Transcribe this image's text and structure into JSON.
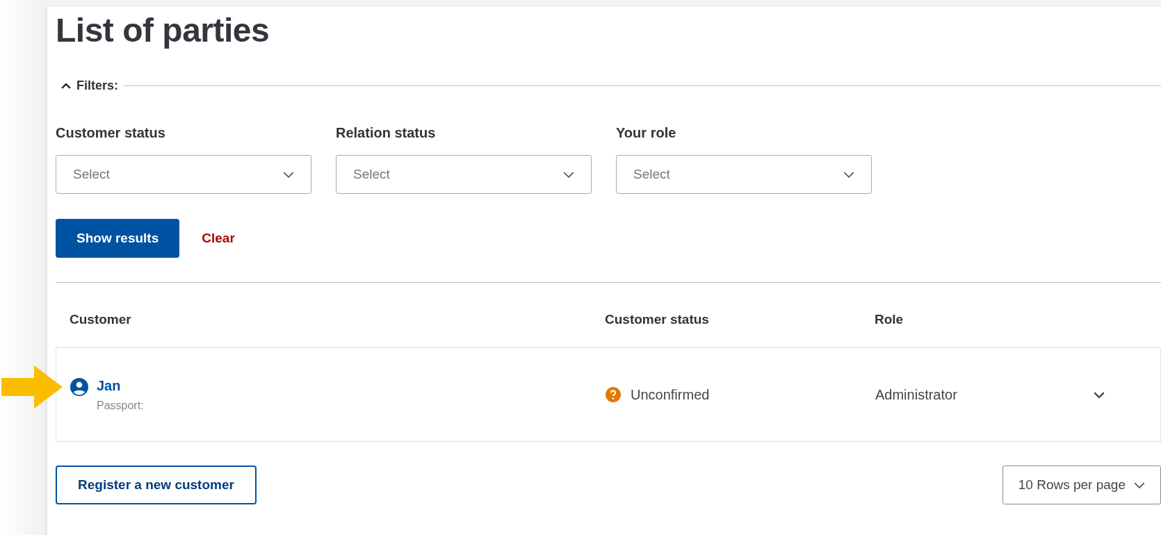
{
  "title": "List of parties",
  "filters": {
    "label": "Filters:",
    "expanded": true,
    "fields": [
      {
        "label": "Customer status",
        "placeholder": "Select"
      },
      {
        "label": "Relation status",
        "placeholder": "Select"
      },
      {
        "label": "Your role",
        "placeholder": "Select"
      }
    ],
    "buttons": [
      {
        "kind": "primary",
        "label": "Show results"
      },
      {
        "kind": "link",
        "label": "Clear"
      }
    ]
  },
  "table": {
    "columns": [
      "Customer",
      "Customer status",
      "Role"
    ],
    "rows": [
      {
        "name": "Jan",
        "detail": "Passport:",
        "status": "Unconfirmed",
        "role": "Administrator",
        "expanded": false,
        "highlighted": true
      }
    ]
  },
  "register_button": "Register a new customer",
  "rows_per_page": "10 Rows per page"
}
